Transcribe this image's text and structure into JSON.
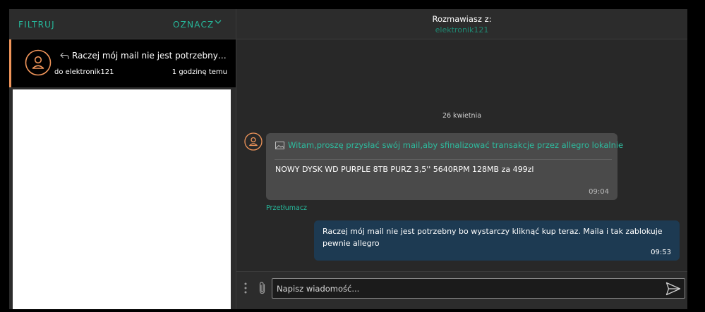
{
  "left_header": {
    "filter_label": "FILTRUJ",
    "mark_label": "OZNACZ"
  },
  "conversation": {
    "snippet": "Raczej mój mail nie jest potrzebny bo wys...",
    "recipient": "do elektronik121",
    "time": "1 godzinę temu"
  },
  "chat_header": {
    "title": "Rozmawiasz z:",
    "partner": "elektronik121"
  },
  "messages": {
    "date_separator": "26 kwietnia",
    "incoming": {
      "subject": "Witam,proszę przysłać swój mail,aby sfinalizować transakcje przez allegro lokalnie",
      "body": "NOWY DYSK WD PURPLE 8TB PURZ 3,5'' 5640RPM 128MB za 499zl",
      "time": "09:04",
      "translate_label": "Przetłumacz"
    },
    "outgoing": {
      "body": "Raczej mój mail nie jest potrzebny bo wystarczy kliknąć kup teraz. Maila i tak zablokuje pewnie allegro",
      "time": "09:53"
    }
  },
  "compose": {
    "placeholder": "Napisz wiadomość..."
  },
  "icons": {
    "chevron": "chevron-down-icon",
    "avatar": "user-avatar-icon",
    "reply": "reply-icon",
    "image": "image-icon",
    "menu": "kebab-menu-icon",
    "attach": "paperclip-icon",
    "send": "send-icon"
  },
  "colors": {
    "accent": "#26b89b",
    "avatar_orange": "#f0955a",
    "outgoing_bubble": "#1d3a52",
    "incoming_bubble": "#4a4a4a"
  }
}
